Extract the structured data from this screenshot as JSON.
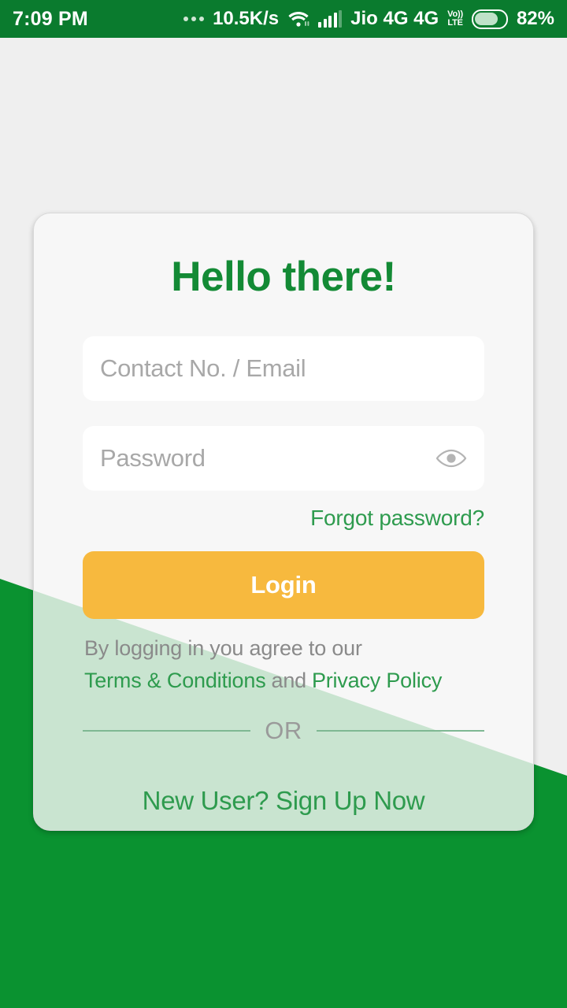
{
  "status_bar": {
    "time": "7:09 PM",
    "dots_icon": "overflow-dots-icon",
    "network_speed": "10.5K/s",
    "wifi_icon": "wifi-icon",
    "signal_icon": "cellular-signal-icon",
    "carrier": "Jio 4G 4G",
    "volte_top": "Vo))",
    "volte_bottom": "LTE",
    "battery_icon": "battery-icon",
    "battery_percent": "82%",
    "background_color": "#0a7b2e",
    "text_color": "#ffffff"
  },
  "card": {
    "title": "Hello there!",
    "title_color": "#138a35",
    "identifier_field": {
      "placeholder": "Contact No. / Email",
      "value": ""
    },
    "password_field": {
      "placeholder": "Password",
      "value": "",
      "toggle_icon": "eye-icon"
    },
    "forgot_password_label": "Forgot password?",
    "login_button_label": "Login",
    "login_button_color": "#f7b93e",
    "terms": {
      "intro": "By logging in you agree to our",
      "terms_link": "Terms & Conditions",
      "conjunction": "and",
      "privacy_link": "Privacy Policy"
    },
    "or_label": "OR",
    "signup_label": "New User? Sign Up Now",
    "link_color": "#2e9b4e"
  },
  "theme": {
    "brand_green": "#0a9230",
    "page_background": "#efefef",
    "accent_amber": "#f7b93e"
  }
}
